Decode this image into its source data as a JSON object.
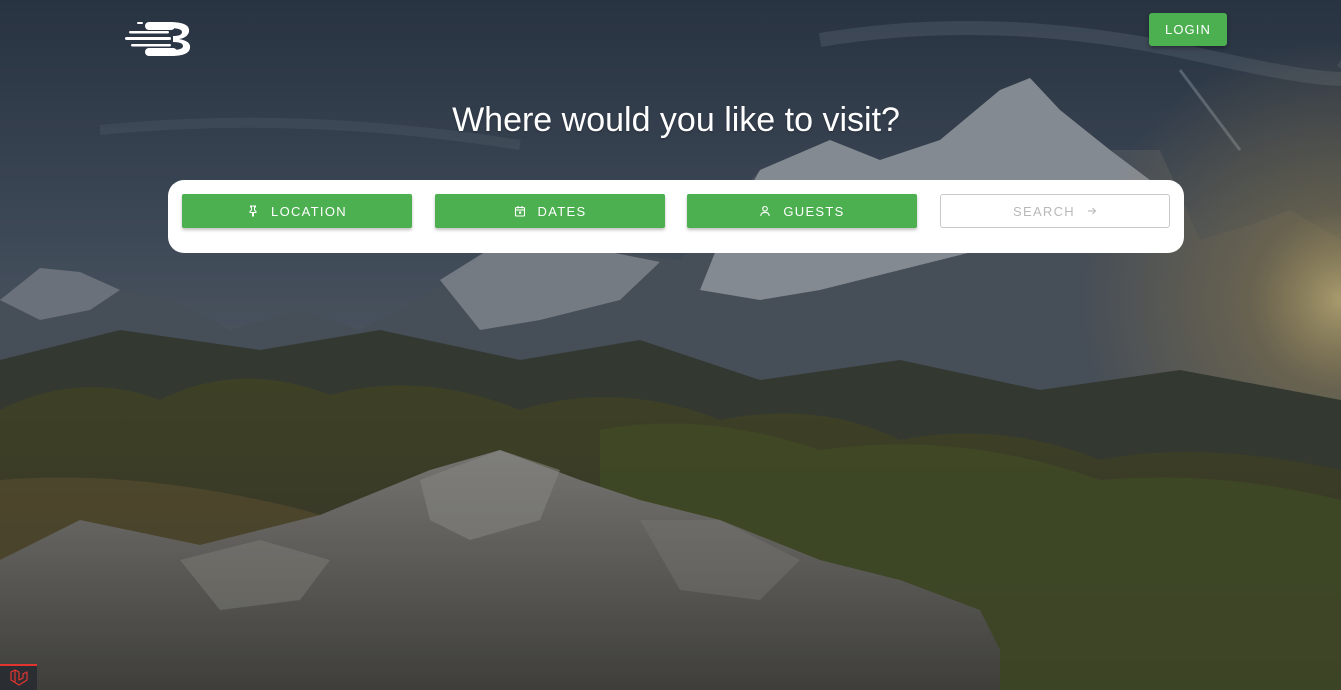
{
  "header": {
    "logo_icon": "speed-b-logo-icon",
    "login_label": "LOGIN"
  },
  "hero": {
    "headline": "Where would you like to visit?"
  },
  "search_bar": {
    "location_label": "LOCATION",
    "location_icon": "pin-icon",
    "dates_label": "DATES",
    "dates_icon": "calendar-icon",
    "guests_label": "GUESTS",
    "guests_icon": "person-icon",
    "search_label": "SEARCH",
    "search_icon": "arrow-right-icon"
  },
  "colors": {
    "accent": "#4caf50",
    "card": "#ffffff",
    "search_text": "#b9b9b9",
    "debug_bar": "#e3342f"
  },
  "corner_badge": {
    "icon": "laravel-icon"
  }
}
